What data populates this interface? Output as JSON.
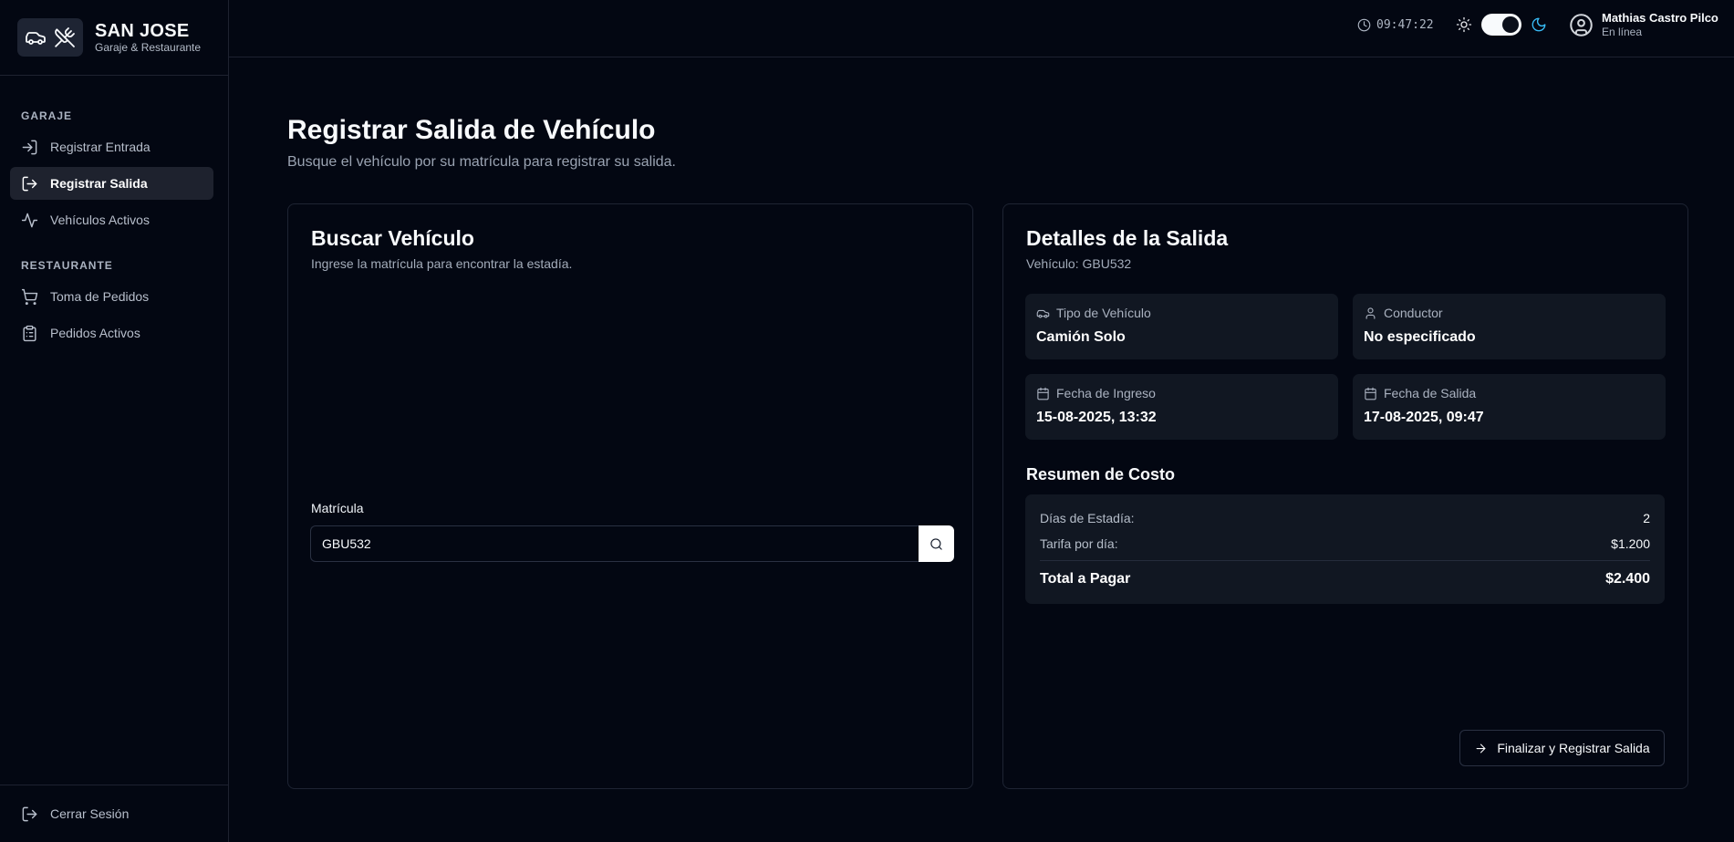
{
  "brand": {
    "title": "SAN JOSE",
    "subtitle": "Garaje & Restaurante",
    "logo_icons": [
      "car-icon",
      "utensils-crossed-icon"
    ]
  },
  "sidebar": {
    "sections": [
      {
        "label": "GARAJE",
        "items": [
          {
            "label": "Registrar Entrada",
            "icon": "log-in-icon",
            "active": false
          },
          {
            "label": "Registrar Salida",
            "icon": "log-out-icon",
            "active": true
          },
          {
            "label": "Vehículos Activos",
            "icon": "activity-icon",
            "active": false
          }
        ]
      },
      {
        "label": "RESTAURANTE",
        "items": [
          {
            "label": "Toma de Pedidos",
            "icon": "shopping-cart-icon",
            "active": false
          },
          {
            "label": "Pedidos Activos",
            "icon": "clipboard-list-icon",
            "active": false
          }
        ]
      }
    ],
    "logout_label": "Cerrar Sesión"
  },
  "header": {
    "clock": "09:47:22",
    "theme_toggle": {
      "mode": "dark",
      "icons": [
        "sun-icon",
        "moon-icon"
      ]
    },
    "user": {
      "name": "Mathias Castro Pilco",
      "status": "En línea"
    }
  },
  "page": {
    "title": "Registrar Salida de Vehículo",
    "subtitle": "Busque el vehículo por su matrícula para registrar su salida."
  },
  "search_card": {
    "title": "Buscar Vehículo",
    "subtitle": "Ingrese la matrícula para encontrar la estadía.",
    "field_label": "Matrícula",
    "field_value": "GBU532"
  },
  "details_card": {
    "title": "Detalles de la Salida",
    "subtitle": "Vehículo: GBU532",
    "info": [
      {
        "label": "Tipo de Vehículo",
        "value": "Camión Solo",
        "icon": "car-icon"
      },
      {
        "label": "Conductor",
        "value": "No especificado",
        "icon": "user-icon"
      },
      {
        "label": "Fecha de Ingreso",
        "value": "15-08-2025, 13:32",
        "icon": "calendar-icon"
      },
      {
        "label": "Fecha de Salida",
        "value": "17-08-2025, 09:47",
        "icon": "calendar-icon"
      }
    ],
    "summary_title": "Resumen de Costo",
    "summary": {
      "days_label": "Días de Estadía:",
      "days_value": "2",
      "rate_label": "Tarifa por día:",
      "rate_value": "$1.200",
      "total_label": "Total a Pagar",
      "total_value": "$2.400"
    },
    "finalize_label": "Finalizar y Registrar Salida"
  },
  "colors": {
    "background": "#030712",
    "card_surface": "#111722",
    "accent_moon": "#38bdf8",
    "active_nav": "#1e222e"
  }
}
